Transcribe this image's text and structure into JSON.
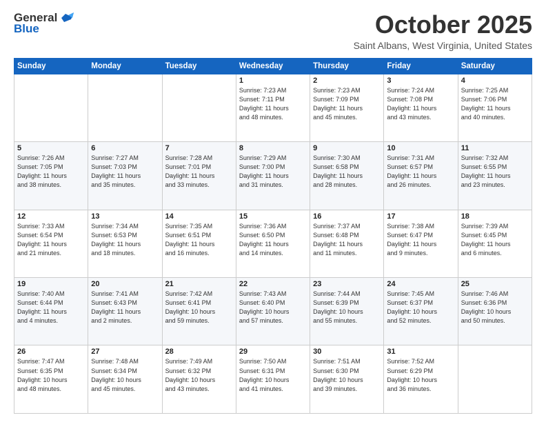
{
  "header": {
    "logo_general": "General",
    "logo_blue": "Blue",
    "month_title": "October 2025",
    "location": "Saint Albans, West Virginia, United States"
  },
  "days_of_week": [
    "Sunday",
    "Monday",
    "Tuesday",
    "Wednesday",
    "Thursday",
    "Friday",
    "Saturday"
  ],
  "weeks": [
    [
      {
        "day": "",
        "info": ""
      },
      {
        "day": "",
        "info": ""
      },
      {
        "day": "",
        "info": ""
      },
      {
        "day": "1",
        "info": "Sunrise: 7:23 AM\nSunset: 7:11 PM\nDaylight: 11 hours\nand 48 minutes."
      },
      {
        "day": "2",
        "info": "Sunrise: 7:23 AM\nSunset: 7:09 PM\nDaylight: 11 hours\nand 45 minutes."
      },
      {
        "day": "3",
        "info": "Sunrise: 7:24 AM\nSunset: 7:08 PM\nDaylight: 11 hours\nand 43 minutes."
      },
      {
        "day": "4",
        "info": "Sunrise: 7:25 AM\nSunset: 7:06 PM\nDaylight: 11 hours\nand 40 minutes."
      }
    ],
    [
      {
        "day": "5",
        "info": "Sunrise: 7:26 AM\nSunset: 7:05 PM\nDaylight: 11 hours\nand 38 minutes."
      },
      {
        "day": "6",
        "info": "Sunrise: 7:27 AM\nSunset: 7:03 PM\nDaylight: 11 hours\nand 35 minutes."
      },
      {
        "day": "7",
        "info": "Sunrise: 7:28 AM\nSunset: 7:01 PM\nDaylight: 11 hours\nand 33 minutes."
      },
      {
        "day": "8",
        "info": "Sunrise: 7:29 AM\nSunset: 7:00 PM\nDaylight: 11 hours\nand 31 minutes."
      },
      {
        "day": "9",
        "info": "Sunrise: 7:30 AM\nSunset: 6:58 PM\nDaylight: 11 hours\nand 28 minutes."
      },
      {
        "day": "10",
        "info": "Sunrise: 7:31 AM\nSunset: 6:57 PM\nDaylight: 11 hours\nand 26 minutes."
      },
      {
        "day": "11",
        "info": "Sunrise: 7:32 AM\nSunset: 6:55 PM\nDaylight: 11 hours\nand 23 minutes."
      }
    ],
    [
      {
        "day": "12",
        "info": "Sunrise: 7:33 AM\nSunset: 6:54 PM\nDaylight: 11 hours\nand 21 minutes."
      },
      {
        "day": "13",
        "info": "Sunrise: 7:34 AM\nSunset: 6:53 PM\nDaylight: 11 hours\nand 18 minutes."
      },
      {
        "day": "14",
        "info": "Sunrise: 7:35 AM\nSunset: 6:51 PM\nDaylight: 11 hours\nand 16 minutes."
      },
      {
        "day": "15",
        "info": "Sunrise: 7:36 AM\nSunset: 6:50 PM\nDaylight: 11 hours\nand 14 minutes."
      },
      {
        "day": "16",
        "info": "Sunrise: 7:37 AM\nSunset: 6:48 PM\nDaylight: 11 hours\nand 11 minutes."
      },
      {
        "day": "17",
        "info": "Sunrise: 7:38 AM\nSunset: 6:47 PM\nDaylight: 11 hours\nand 9 minutes."
      },
      {
        "day": "18",
        "info": "Sunrise: 7:39 AM\nSunset: 6:45 PM\nDaylight: 11 hours\nand 6 minutes."
      }
    ],
    [
      {
        "day": "19",
        "info": "Sunrise: 7:40 AM\nSunset: 6:44 PM\nDaylight: 11 hours\nand 4 minutes."
      },
      {
        "day": "20",
        "info": "Sunrise: 7:41 AM\nSunset: 6:43 PM\nDaylight: 11 hours\nand 2 minutes."
      },
      {
        "day": "21",
        "info": "Sunrise: 7:42 AM\nSunset: 6:41 PM\nDaylight: 10 hours\nand 59 minutes."
      },
      {
        "day": "22",
        "info": "Sunrise: 7:43 AM\nSunset: 6:40 PM\nDaylight: 10 hours\nand 57 minutes."
      },
      {
        "day": "23",
        "info": "Sunrise: 7:44 AM\nSunset: 6:39 PM\nDaylight: 10 hours\nand 55 minutes."
      },
      {
        "day": "24",
        "info": "Sunrise: 7:45 AM\nSunset: 6:37 PM\nDaylight: 10 hours\nand 52 minutes."
      },
      {
        "day": "25",
        "info": "Sunrise: 7:46 AM\nSunset: 6:36 PM\nDaylight: 10 hours\nand 50 minutes."
      }
    ],
    [
      {
        "day": "26",
        "info": "Sunrise: 7:47 AM\nSunset: 6:35 PM\nDaylight: 10 hours\nand 48 minutes."
      },
      {
        "day": "27",
        "info": "Sunrise: 7:48 AM\nSunset: 6:34 PM\nDaylight: 10 hours\nand 45 minutes."
      },
      {
        "day": "28",
        "info": "Sunrise: 7:49 AM\nSunset: 6:32 PM\nDaylight: 10 hours\nand 43 minutes."
      },
      {
        "day": "29",
        "info": "Sunrise: 7:50 AM\nSunset: 6:31 PM\nDaylight: 10 hours\nand 41 minutes."
      },
      {
        "day": "30",
        "info": "Sunrise: 7:51 AM\nSunset: 6:30 PM\nDaylight: 10 hours\nand 39 minutes."
      },
      {
        "day": "31",
        "info": "Sunrise: 7:52 AM\nSunset: 6:29 PM\nDaylight: 10 hours\nand 36 minutes."
      },
      {
        "day": "",
        "info": ""
      }
    ]
  ]
}
